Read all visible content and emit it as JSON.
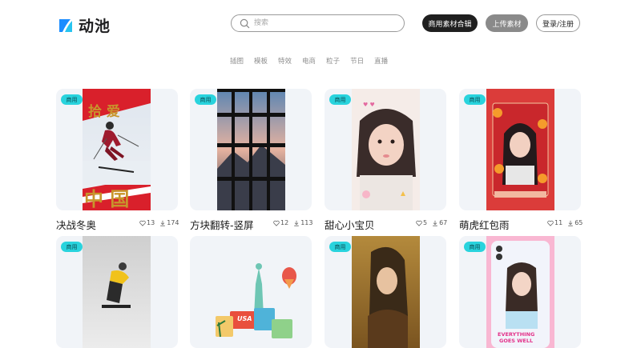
{
  "header": {
    "logo_text": "动池",
    "search_placeholder": "搜索",
    "btn_collection": "商用素材合辑",
    "btn_upload": "上传素材",
    "btn_login": "登录/注册"
  },
  "categories": [
    "插图",
    "模板",
    "特效",
    "电商",
    "粒子",
    "节日",
    "直播"
  ],
  "badge": "商用",
  "cards": [
    {
      "title": "决战冬奥",
      "likes": "13",
      "downloads": "174"
    },
    {
      "title": "方块翻转-竖屏",
      "likes": "12",
      "downloads": "113"
    },
    {
      "title": "甜心小宝贝",
      "likes": "5",
      "downloads": "67"
    },
    {
      "title": "萌虎红包雨",
      "likes": "11",
      "downloads": "65"
    }
  ],
  "thumb_text": {
    "ski_top": "拾 爱",
    "ski_bottom": "中 国",
    "usa": "USA",
    "phone_caption_1": "EVERYTHING",
    "phone_caption_2": "GOES WELL"
  },
  "colors": {
    "badge": "#29d3dd",
    "dark_button": "#1f1f1f",
    "gray_button": "#8a8a8a",
    "logo_blue": "#1a8cff"
  }
}
